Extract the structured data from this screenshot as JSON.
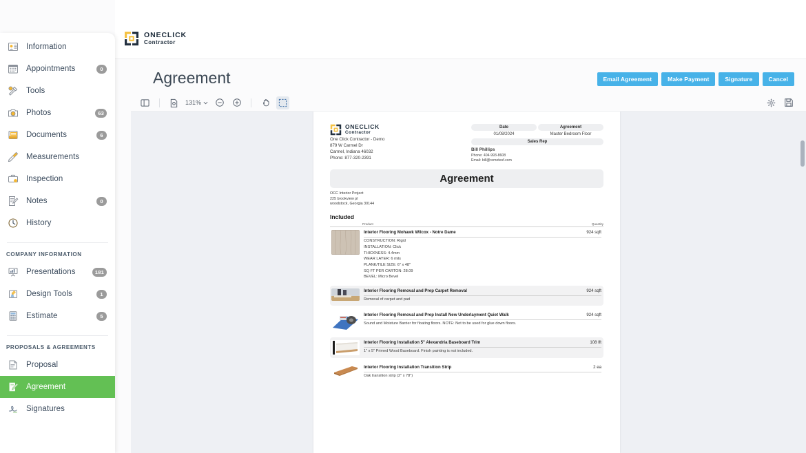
{
  "brand": {
    "name_top": "ONECLICK",
    "name_bottom": "Contractor"
  },
  "header": {
    "page_title": "Agreement",
    "buttons": [
      {
        "label": "Email Agreement",
        "name": "email-agreement-button"
      },
      {
        "label": "Make Payment",
        "name": "make-payment-button"
      },
      {
        "label": "Signature",
        "name": "signature-button"
      },
      {
        "label": "Cancel",
        "name": "cancel-button"
      }
    ]
  },
  "sidebar": {
    "primary": [
      {
        "label": "Information",
        "icon": "id-card-icon",
        "badge": null
      },
      {
        "label": "Appointments",
        "icon": "calendar-icon",
        "badge": "0"
      },
      {
        "label": "Tools",
        "icon": "tools-icon",
        "badge": null
      },
      {
        "label": "Photos",
        "icon": "camera-icon",
        "badge": "63"
      },
      {
        "label": "Documents",
        "icon": "folder-icon",
        "badge": "6"
      },
      {
        "label": "Measurements",
        "icon": "ruler-icon",
        "badge": null
      },
      {
        "label": "Inspection",
        "icon": "briefcase-icon",
        "badge": null
      },
      {
        "label": "Notes",
        "icon": "note-edit-icon",
        "badge": "0"
      },
      {
        "label": "History",
        "icon": "clock-icon",
        "badge": null
      }
    ],
    "company_section_title": "COMPANY INFORMATION",
    "company": [
      {
        "label": "Presentations",
        "icon": "presentation-icon",
        "badge": "181"
      },
      {
        "label": "Design Tools",
        "icon": "design-tools-icon",
        "badge": "1"
      },
      {
        "label": "Estimate",
        "icon": "calculator-icon",
        "badge": "5"
      }
    ],
    "proposals_section_title": "PROPOSALS & AGREEMENTS",
    "proposals": [
      {
        "label": "Proposal",
        "icon": "document-icon",
        "badge": null,
        "active": false
      },
      {
        "label": "Agreement",
        "icon": "agreement-pen-icon",
        "badge": null,
        "active": true
      },
      {
        "label": "Signatures",
        "icon": "signature-icon",
        "badge": null,
        "active": false
      }
    ],
    "active_color": "#63c054"
  },
  "pdf_toolbar": {
    "sidebar_toggle": "panel-toggle-icon",
    "page_thumb": "page-view-icon",
    "zoom_level": "131%",
    "zoom_out": "zoom-out-icon",
    "zoom_in": "zoom-in-icon",
    "pan_tool": "hand-tool-icon",
    "select_tool": "marquee-select-icon",
    "settings": "gear-icon",
    "save": "save-icon"
  },
  "document": {
    "company": {
      "line1": "One Click Contractor - Demo",
      "line2": "879 W Carmel Dr",
      "line3": "Carmel, Indiana 46032",
      "line4": "Phone: 877-320-2391"
    },
    "meta": {
      "date_label": "Date",
      "date_value": "01/08/2024",
      "agreement_label": "Agreement",
      "agreement_value": "Master Bedroom Floor",
      "sales_rep_label": "Sales Rep",
      "rep_name": "Bill Phillips",
      "rep_phone": "Phone: 404-993-8608",
      "rep_email": "Email: bill@remotesf.com"
    },
    "title": "Agreement",
    "project": {
      "line1": "OCC Interior Project",
      "line2": "225 brookview pl",
      "line3": "woodstock, Georgia 30144"
    },
    "section_title": "Included",
    "table": {
      "col_product": "Product",
      "col_quantity": "Quantity"
    },
    "line_items": [
      {
        "name": "Interior Flooring Mohawk Wilcox - Notre Dame",
        "quantity": "924 sqft",
        "thumb": "wood-plank-thumb",
        "specs": [
          "CONSTRUCTION: Rigid",
          "INSTALLATION: Click",
          "THICKNESS: 4.4mm",
          "WEAR LAYER: 6 mils",
          "PLANK/TILE SIZE: 6\" x 48\"",
          "SQ FT PER CARTON: 28.09",
          "BEVEL: Micro Bevel"
        ],
        "shaded": false
      },
      {
        "name": "Interior Flooring Removal and Prep Carpet Removal",
        "quantity": "924 sqft",
        "thumb": "carpet-removal-thumb",
        "specs": [
          "Removal of carpet and pad"
        ],
        "shaded": true
      },
      {
        "name": "Interior Flooring Removal and Prep Install New Underlayment Quiet Walk",
        "quantity": "924 sqft",
        "thumb": "underlayment-roll-thumb",
        "specs": [
          "Sound and Moisture Barrier for floating floors.  NOTE: Not to be used for glue down floors."
        ],
        "shaded": false
      },
      {
        "name": "Interior Flooring Installation 5\" Alexandria Baseboard Trim",
        "quantity": "108 lft",
        "thumb": "baseboard-trim-thumb",
        "specs": [
          "1\" x 5\" Primed Wood Baseboard.  Finish painting is not included."
        ],
        "shaded": true
      },
      {
        "name": "Interior Flooring Installation Transition Strip",
        "quantity": "2 ea",
        "thumb": "transition-strip-thumb",
        "specs": [
          "Oak transition strip (2\" x 78\")"
        ],
        "shaded": false
      }
    ]
  }
}
